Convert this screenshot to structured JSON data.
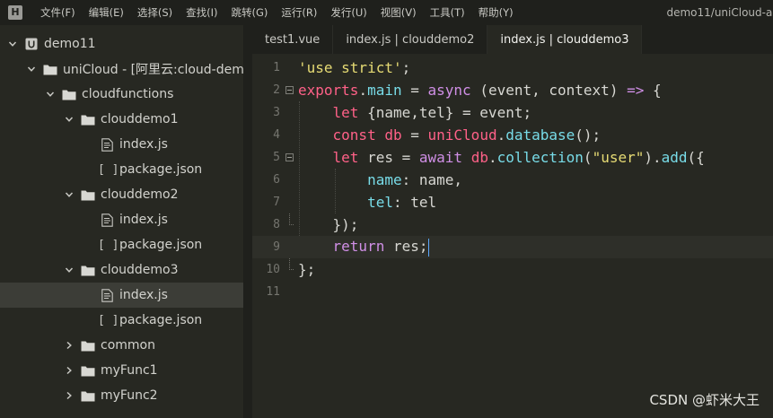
{
  "menubar": {
    "logo": "H",
    "items": [
      "文件(F)",
      "编辑(E)",
      "选择(S)",
      "查找(I)",
      "跳转(G)",
      "运行(R)",
      "发行(U)",
      "视图(V)",
      "工具(T)",
      "帮助(Y)"
    ],
    "window_title": "demo11/uniCloud-ali"
  },
  "sidebar": {
    "nodes": [
      {
        "label": "demo11",
        "icon": "project-icon",
        "expanded": true
      },
      {
        "label": "uniCloud - [阿里云:cloud-demo",
        "icon": "folder-icon",
        "expanded": true
      },
      {
        "label": "cloudfunctions",
        "icon": "folder-icon",
        "expanded": true
      },
      {
        "label": "clouddemo1",
        "icon": "folder-icon",
        "expanded": true
      },
      {
        "label": "index.js",
        "icon": "js-file-icon"
      },
      {
        "label": "package.json",
        "icon": "json-file-icon",
        "prefix": "[ ]"
      },
      {
        "label": "clouddemo2",
        "icon": "folder-icon",
        "expanded": true
      },
      {
        "label": "index.js",
        "icon": "js-file-icon"
      },
      {
        "label": "package.json",
        "icon": "json-file-icon",
        "prefix": "[ ]"
      },
      {
        "label": "clouddemo3",
        "icon": "folder-icon",
        "expanded": true
      },
      {
        "label": "index.js",
        "icon": "js-file-icon",
        "selected": true
      },
      {
        "label": "package.json",
        "icon": "json-file-icon",
        "prefix": "[ ]"
      },
      {
        "label": "common",
        "icon": "folder-icon",
        "expanded": false
      },
      {
        "label": "myFunc1",
        "icon": "folder-icon",
        "expanded": false
      },
      {
        "label": "myFunc2",
        "icon": "folder-icon",
        "expanded": false
      }
    ]
  },
  "tabs": [
    {
      "label": "test1.vue",
      "active": false
    },
    {
      "label": "index.js | clouddemo2",
      "active": false
    },
    {
      "label": "index.js | clouddemo3",
      "active": true
    }
  ],
  "editor": {
    "line_numbers": [
      "1",
      "2",
      "3",
      "4",
      "5",
      "6",
      "7",
      "8",
      "9",
      "10",
      "11"
    ],
    "current_line": 9,
    "lines": [
      "'use strict';",
      "exports.main = async (event, context) => {",
      "    let {name,tel} = event;",
      "    const db = uniCloud.database();",
      "    let res = await db.collection(\"user\").add({",
      "        name: name,",
      "        tel: tel",
      "    });",
      "    return res;",
      "};",
      ""
    ]
  },
  "watermark": "CSDN @虾米大王",
  "colors": {
    "background": "#272822",
    "keyword": "#ff6188",
    "string": "#e6db74",
    "function": "#a6e22e",
    "property": "#78dce8"
  }
}
